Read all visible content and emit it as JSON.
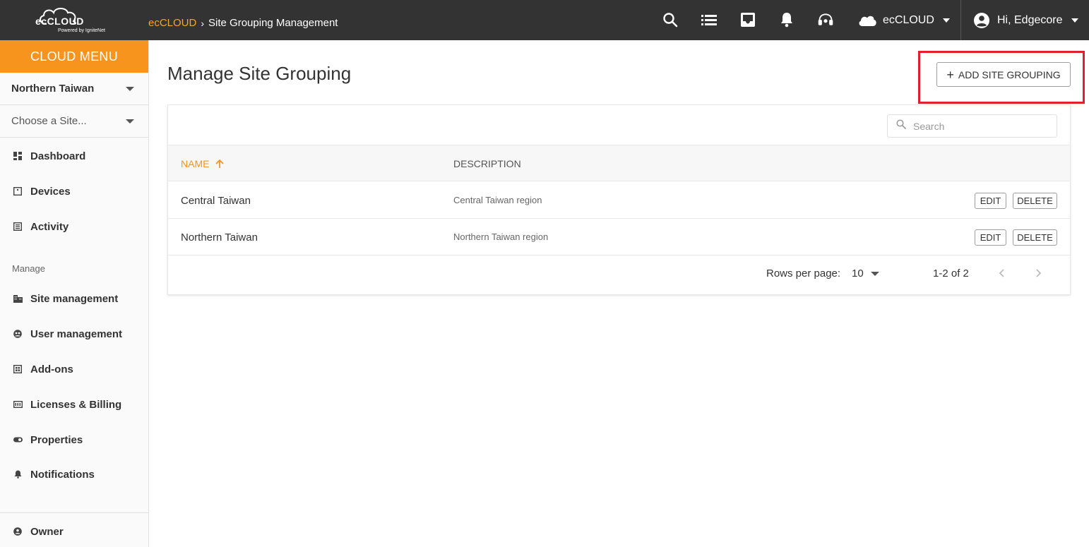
{
  "topbar": {
    "logo_text": "ecCLOUD",
    "logo_sub": "Powered by IgniteNet",
    "breadcrumb_root": "ecCLOUD",
    "breadcrumb_sep": "›",
    "breadcrumb_current": "Site Grouping Management",
    "icons": [
      "search-icon",
      "list-icon",
      "inbox-icon",
      "bell-icon",
      "support-icon"
    ],
    "cloud_label": "ecCLOUD",
    "user_label": "Hi, Edgecore"
  },
  "sidebar": {
    "menu_title": "CLOUD MENU",
    "group_select": "Northern Taiwan",
    "site_select": "Choose a Site...",
    "items": [
      {
        "label": "Dashboard",
        "icon": "dashboard-icon"
      },
      {
        "label": "Devices",
        "icon": "devices-icon"
      },
      {
        "label": "Activity",
        "icon": "activity-icon"
      }
    ],
    "manage_section": "Manage",
    "manage_items": [
      {
        "label": "Site management",
        "icon": "site-icon"
      },
      {
        "label": "User management",
        "icon": "user-management-icon"
      },
      {
        "label": "Add-ons",
        "icon": "add-ons-icon"
      },
      {
        "label": "Licenses & Billing",
        "icon": "licenses-icon"
      },
      {
        "label": "Properties",
        "icon": "properties-icon"
      },
      {
        "label": "Notifications",
        "icon": "notifications-icon"
      }
    ],
    "owner": {
      "label": "Owner",
      "icon": "owner-icon"
    }
  },
  "main": {
    "title": "Manage Site Grouping",
    "add_button": "ADD SITE GROUPING",
    "search_placeholder": "Search",
    "columns": {
      "name": "NAME",
      "description": "DESCRIPTION"
    },
    "rows": [
      {
        "name": "Central Taiwan",
        "description": "Central Taiwan region",
        "edit": "EDIT",
        "delete": "DELETE"
      },
      {
        "name": "Northern Taiwan",
        "description": "Northern Taiwan region",
        "edit": "EDIT",
        "delete": "DELETE"
      }
    ],
    "pager": {
      "rows_per_page_label": "Rows per page:",
      "rows_per_page_value": "10",
      "range": "1-2 of 2"
    }
  },
  "colors": {
    "topbar": "#333333",
    "accent": "#f7941d",
    "highlight": "#e0202a"
  }
}
